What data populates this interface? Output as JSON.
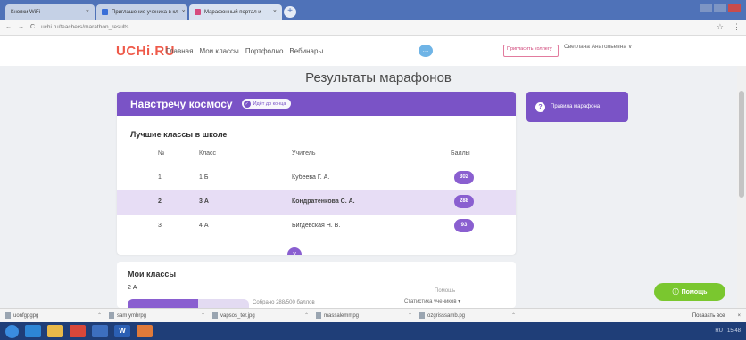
{
  "browser": {
    "tabs": [
      {
        "label": "Кнопки WiFi"
      },
      {
        "label": "Приглашение ученика в кл"
      },
      {
        "label": "Марафонный портал и"
      }
    ],
    "url": "uchi.ru/teachers/marathon_results",
    "nav_back": "←",
    "nav_forward": "→",
    "reload": "C",
    "star": "☆",
    "menu": "⋮"
  },
  "header": {
    "logo": "UCHi.RU",
    "nav": [
      "Главная",
      "Мои классы",
      "Портфолио",
      "Вебинары"
    ],
    "chat_icon": "…",
    "promo_link": "Пригласить коллегу",
    "user_name": "Светлана Анатольевна ∨"
  },
  "page_title": "Результаты марафонов",
  "marathon": {
    "title": "Навстречу космосу",
    "status_pill": "Идёт до конца",
    "status_icon": "✓",
    "section_title": "Лучшие классы в школе",
    "columns": {
      "num": "№",
      "class": "Класс",
      "teacher": "Учитель",
      "points": "Баллы"
    },
    "rows": [
      {
        "num": "1",
        "class": "1 Б",
        "teacher": "Кубеева Г. А.",
        "points": "302"
      },
      {
        "num": "2",
        "class": "3 А",
        "teacher": "Кондратенкова С. А.",
        "points": "288"
      },
      {
        "num": "3",
        "class": "4 А",
        "teacher": "Бигдевская Н. В.",
        "points": "93"
      }
    ],
    "expand_icon": "∨"
  },
  "my_classes": {
    "title": "Мои классы",
    "class_name": "2 А",
    "progress": 0.58,
    "collected": "Собрано 288/500 баллов",
    "hint": "Помощь",
    "stats_link": "Статистика учеников ▾"
  },
  "side": {
    "icon": "?",
    "rules_label": "Правила марафона"
  },
  "help_button": {
    "icon": "ⓘ",
    "label": "Помощь"
  },
  "downloads": {
    "items": [
      {
        "name": "uonfgpgpg"
      },
      {
        "name": "sam ymbrpg"
      },
      {
        "name": "vapsos_ter.jpg"
      },
      {
        "name": "massalemmpg"
      },
      {
        "name": "ozgrisssamb.pg"
      }
    ],
    "show_all": "Показать все",
    "close": "×"
  },
  "taskbar": {
    "word_label": "W",
    "tray": [
      "RU",
      "15:48"
    ]
  },
  "colors": {
    "accent": "#7a53c6",
    "row_highlight": "#e7ddf5",
    "help_green": "#7ac72f",
    "logo_red": "#ef5a4a",
    "browser_blue": "#4f72b8"
  }
}
